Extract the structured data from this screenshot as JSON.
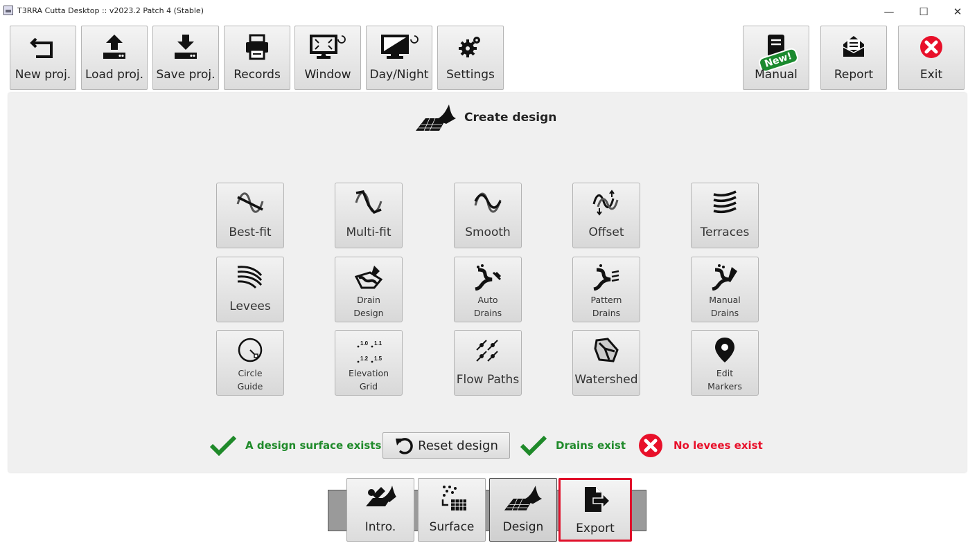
{
  "window": {
    "title": "T3RRA Cutta Desktop :: v2023.2 Patch 4 (Stable)",
    "controls": {
      "minimize": "—",
      "maximize": "☐",
      "close": "✕"
    }
  },
  "toolbar": {
    "new_proj": "New proj.",
    "load_proj": "Load proj.",
    "save_proj": "Save proj.",
    "records": "Records",
    "window": "Window",
    "day_night": "Day/Night",
    "settings": "Settings",
    "manual": "Manual",
    "manual_badge": "New!",
    "report": "Report",
    "exit": "Exit"
  },
  "main": {
    "title": "Create design",
    "tools": {
      "best_fit": "Best-fit",
      "multi_fit": "Multi-fit",
      "smooth": "Smooth",
      "offset": "Offset",
      "terraces": "Terraces",
      "levees": "Levees",
      "drain_design": [
        "Drain",
        "Design"
      ],
      "auto_drains": [
        "Auto",
        "Drains"
      ],
      "pattern_drains": [
        "Pattern",
        "Drains"
      ],
      "manual_drains": [
        "Manual",
        "Drains"
      ],
      "circle_guide": [
        "Circle",
        "Guide"
      ],
      "elevation_grid": [
        "Elevation",
        "Grid"
      ],
      "elevation_grid_values": [
        "1.0",
        "1.1",
        "1.2",
        "1.5"
      ],
      "flow_paths": "Flow Paths",
      "watershed": "Watershed",
      "edit_markers": [
        "Edit",
        "Markers"
      ]
    },
    "status": {
      "design_surface": "A design surface exists",
      "reset_design": "Reset design",
      "drains": "Drains exist",
      "levees": "No levees exist"
    }
  },
  "tabs": {
    "intro": "Intro.",
    "surface": "Surface",
    "design": "Design",
    "export": "Export"
  },
  "colors": {
    "ok_green": "#1f8a2a",
    "error_red": "#e8102a",
    "highlight_red": "#e0102a"
  }
}
